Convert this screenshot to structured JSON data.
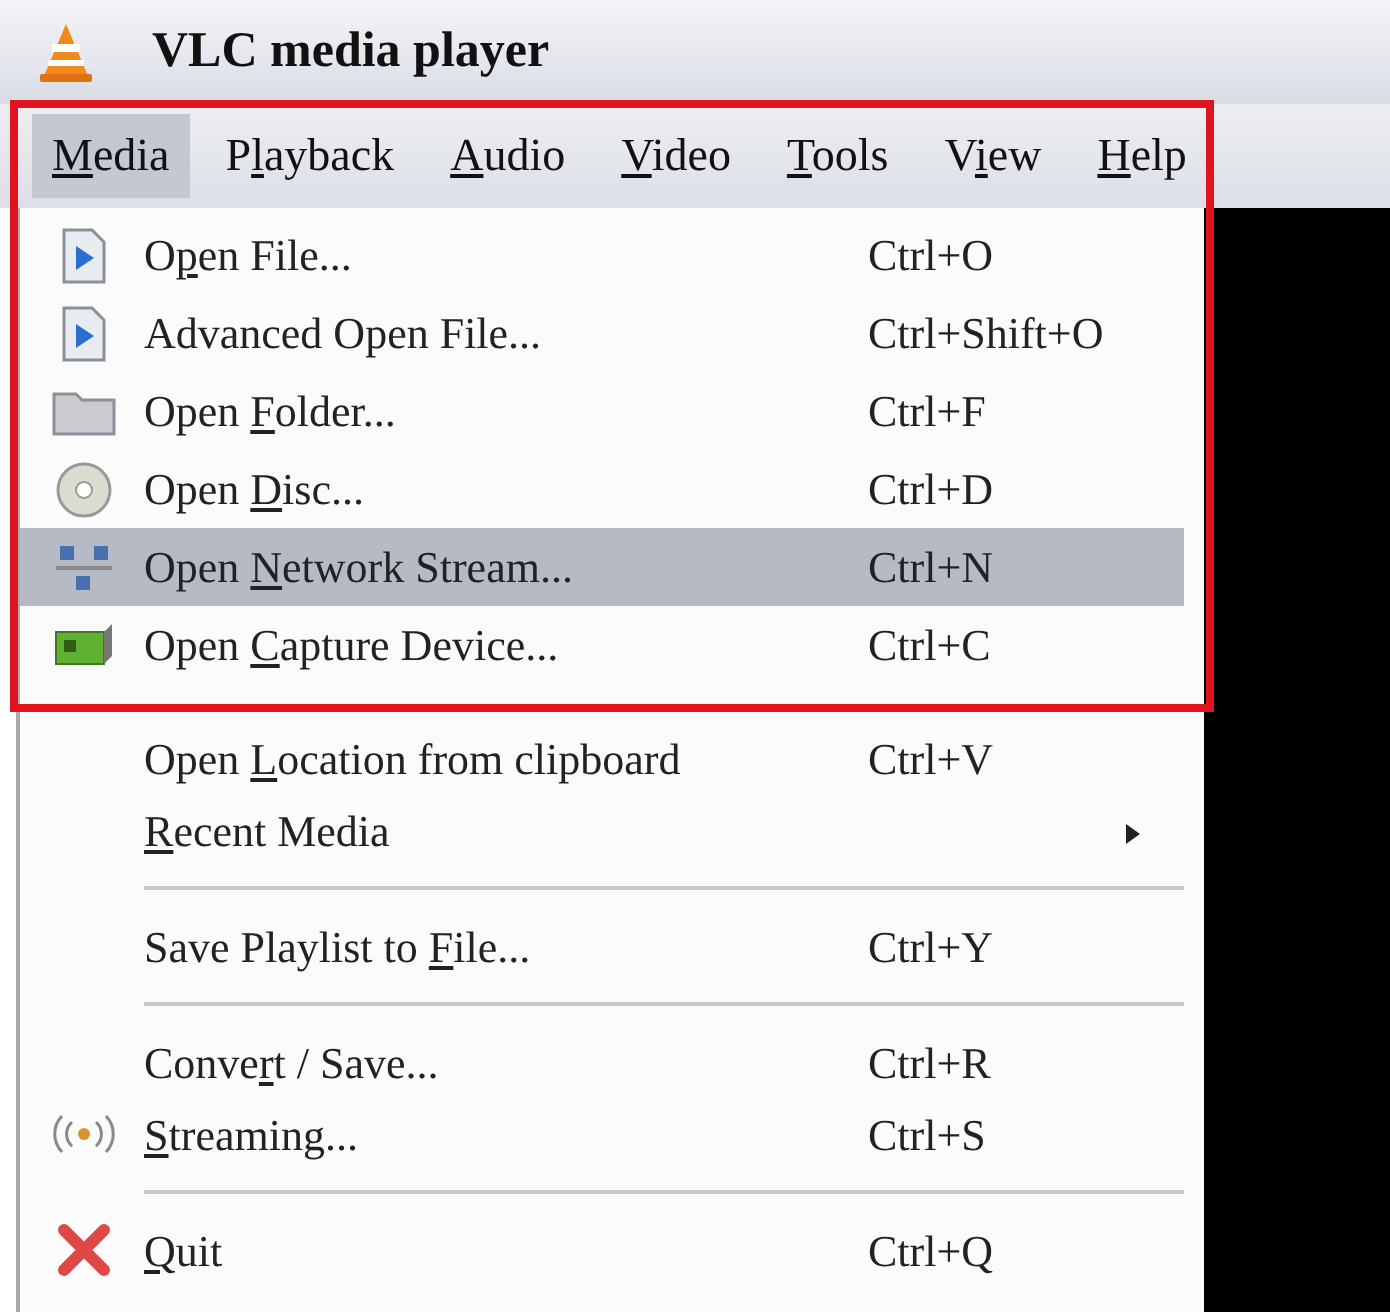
{
  "window": {
    "title": "VLC media player"
  },
  "menu_bar": [
    {
      "parts": [
        {
          "text": "M",
          "underline": true
        },
        {
          "text": "edia"
        }
      ],
      "selected": true
    },
    {
      "parts": [
        {
          "text": "P"
        },
        {
          "text": "l",
          "underline": true
        },
        {
          "text": "ayback"
        }
      ],
      "selected": false
    },
    {
      "parts": [
        {
          "text": "A",
          "underline": true
        },
        {
          "text": "udio"
        }
      ],
      "selected": false
    },
    {
      "parts": [
        {
          "text": "V",
          "underline": true
        },
        {
          "text": "ideo"
        }
      ],
      "selected": false
    },
    {
      "parts": [
        {
          "text": "T",
          "underline": true
        },
        {
          "text": "ools"
        }
      ],
      "selected": false
    },
    {
      "parts": [
        {
          "text": "V"
        },
        {
          "text": "i",
          "underline": true
        },
        {
          "text": "ew"
        }
      ],
      "selected": false
    },
    {
      "parts": [
        {
          "text": "H",
          "underline": true
        },
        {
          "text": "elp"
        }
      ],
      "selected": false
    }
  ],
  "menu": [
    {
      "kind": "item",
      "parts": [
        {
          "text": "O"
        },
        {
          "text": "p",
          "underline": true
        },
        {
          "text": "en File..."
        }
      ],
      "shortcut": "Ctrl+O",
      "selected": false
    },
    {
      "kind": "item",
      "parts": [
        {
          "text": "Advanced Open File..."
        }
      ],
      "shortcut": "Ctrl+Shift+O",
      "selected": false
    },
    {
      "kind": "item",
      "parts": [
        {
          "text": "Open "
        },
        {
          "text": "F",
          "underline": true
        },
        {
          "text": "older..."
        }
      ],
      "shortcut": "Ctrl+F",
      "selected": false
    },
    {
      "kind": "item",
      "parts": [
        {
          "text": "Open "
        },
        {
          "text": "D",
          "underline": true
        },
        {
          "text": "isc..."
        }
      ],
      "shortcut": "Ctrl+D",
      "selected": false
    },
    {
      "kind": "item",
      "parts": [
        {
          "text": "Open "
        },
        {
          "text": "N",
          "underline": true
        },
        {
          "text": "etwork Stream..."
        }
      ],
      "shortcut": "Ctrl+N",
      "selected": true
    },
    {
      "kind": "item",
      "parts": [
        {
          "text": "Open "
        },
        {
          "text": "C",
          "underline": true
        },
        {
          "text": "apture Device..."
        }
      ],
      "shortcut": "Ctrl+C",
      "selected": false
    },
    {
      "kind": "item",
      "parts": [
        {
          "text": "Open "
        },
        {
          "text": "L",
          "underline": true
        },
        {
          "text": "ocation from clipboard"
        }
      ],
      "shortcut": "Ctrl+V",
      "selected": false
    },
    {
      "kind": "item",
      "parts": [
        {
          "text": "R",
          "underline": true
        },
        {
          "text": "ecent Media"
        }
      ],
      "submenu": true,
      "selected": false
    },
    {
      "kind": "separator"
    },
    {
      "kind": "item",
      "parts": [
        {
          "text": "Save Playlist to "
        },
        {
          "text": "F",
          "underline": true
        },
        {
          "text": "ile..."
        }
      ],
      "shortcut": "Ctrl+Y",
      "selected": false
    },
    {
      "kind": "separator"
    },
    {
      "kind": "item",
      "parts": [
        {
          "text": "Conve"
        },
        {
          "text": "r",
          "underline": true
        },
        {
          "text": "t / Save..."
        }
      ],
      "shortcut": "Ctrl+R",
      "selected": false
    },
    {
      "kind": "item",
      "parts": [
        {
          "text": "S",
          "underline": true
        },
        {
          "text": "treaming..."
        }
      ],
      "shortcut": "Ctrl+S",
      "selected": false
    },
    {
      "kind": "separator"
    },
    {
      "kind": "item",
      "parts": [
        {
          "text": "Q",
          "underline": true
        },
        {
          "text": "uit"
        }
      ],
      "shortcut": "Ctrl+Q",
      "selected": false
    }
  ],
  "annotation": {
    "kind": "frame"
  }
}
